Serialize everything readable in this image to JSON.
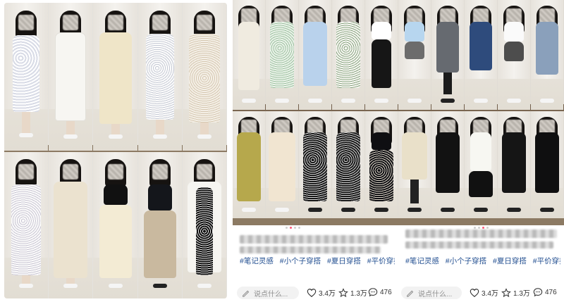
{
  "posts": [
    {
      "id": "post-left-tags",
      "tags": [
        "#笔记灵感",
        "#小个子穿搭",
        "#夏日穿搭",
        "#平价穿搭分"
      ],
      "comment_placeholder": "说点什么...",
      "likes": "3.4万",
      "favorites": "1.3万",
      "comments": "476"
    },
    {
      "id": "post-right-tags",
      "tags": [
        "#笔记灵感",
        "#小个子穿搭",
        "#夏日穿搭",
        "#平价穿搭分"
      ],
      "comment_placeholder": "说点什么...",
      "likes": "3.4万",
      "favorites": "1.3万",
      "comments": "476"
    }
  ],
  "colors": {
    "tag": "#1f4c8f",
    "active_dot": "#ff5a7a",
    "icon": "#333333"
  },
  "icons": [
    "pencil-icon",
    "heart-icon",
    "star-icon",
    "comment-icon"
  ]
}
